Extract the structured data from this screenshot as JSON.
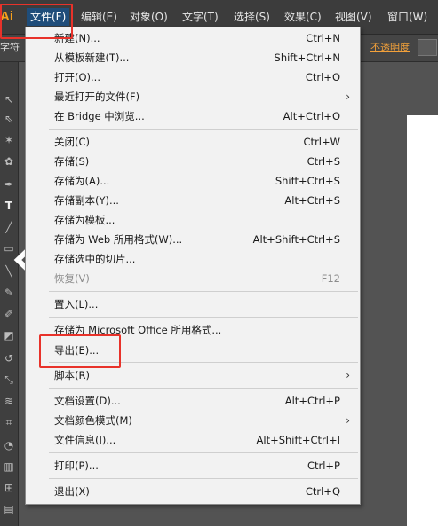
{
  "app": {
    "logo": "Ai",
    "accent": "#f7a01c"
  },
  "menubar": {
    "items": [
      {
        "label": "文件(F)",
        "active": true
      },
      {
        "label": "编辑(E)"
      },
      {
        "label": "对象(O)"
      },
      {
        "label": "文字(T)"
      },
      {
        "label": "选择(S)"
      },
      {
        "label": "效果(C)"
      },
      {
        "label": "视图(V)"
      },
      {
        "label": "窗口(W)"
      }
    ]
  },
  "controlbar": {
    "left_label": "字符",
    "opacity_label": "不透明度"
  },
  "tools": [
    "selection-tool",
    "direct-selection-tool",
    "magic-wand-tool",
    "lasso-tool",
    "pen-tool",
    "type-tool",
    "line-tool",
    "rectangle-tool",
    "paintbrush-tool",
    "pencil-tool",
    "blob-brush-tool",
    "eraser-tool",
    "rotate-tool",
    "scale-tool",
    "width-tool",
    "free-transform-tool",
    "shape-builder-tool",
    "graph-tool",
    "mesh-tool",
    "gradient-tool"
  ],
  "file_menu": {
    "items": [
      {
        "label": "新建(N)...",
        "shortcut": "Ctrl+N"
      },
      {
        "label": "从模板新建(T)...",
        "shortcut": "Shift+Ctrl+N"
      },
      {
        "label": "打开(O)...",
        "shortcut": "Ctrl+O"
      },
      {
        "label": "最近打开的文件(F)",
        "shortcut": "",
        "submenu": true
      },
      {
        "label": "在 Bridge 中浏览...",
        "shortcut": "Alt+Ctrl+O"
      },
      {
        "label": "关闭(C)",
        "shortcut": "Ctrl+W"
      },
      {
        "label": "存储(S)",
        "shortcut": "Ctrl+S"
      },
      {
        "label": "存储为(A)...",
        "shortcut": "Shift+Ctrl+S"
      },
      {
        "label": "存储副本(Y)...",
        "shortcut": "Alt+Ctrl+S"
      },
      {
        "label": "存储为模板...",
        "shortcut": ""
      },
      {
        "label": "存储为 Web 所用格式(W)...",
        "shortcut": "Alt+Shift+Ctrl+S"
      },
      {
        "label": "存储选中的切片...",
        "shortcut": ""
      },
      {
        "label": "恢复(V)",
        "shortcut": "F12",
        "disabled": true
      },
      {
        "label": "置入(L)...",
        "shortcut": ""
      },
      {
        "label": "存储为 Microsoft Office 所用格式...",
        "shortcut": ""
      },
      {
        "label": "导出(E)...",
        "shortcut": "",
        "highlighted": true
      },
      {
        "label": "脚本(R)",
        "shortcut": "",
        "submenu": true
      },
      {
        "label": "文档设置(D)...",
        "shortcut": "Alt+Ctrl+P"
      },
      {
        "label": "文档颜色模式(M)",
        "shortcut": "",
        "submenu": true
      },
      {
        "label": "文件信息(I)...",
        "shortcut": "Alt+Shift+Ctrl+I"
      },
      {
        "label": "打印(P)...",
        "shortcut": "Ctrl+P"
      },
      {
        "label": "退出(X)",
        "shortcut": "Ctrl+Q"
      }
    ],
    "submenu_glyph": "›"
  },
  "highlight_color": "#e8322a"
}
